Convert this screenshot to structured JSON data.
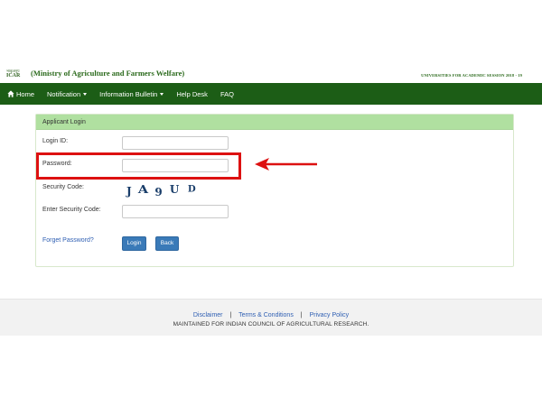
{
  "header": {
    "logo_line1": "भाकृअनुप",
    "logo_line2": "ICAR",
    "ministry": "(Ministry of Agriculture and Farmers Welfare)",
    "session": "UNIVERSITIES FOR ACADEMIC SESSION 2018 - 19"
  },
  "nav": {
    "home": "Home",
    "notification": "Notification",
    "bulletin": "Information Bulletin",
    "helpdesk": "Help Desk",
    "faq": "FAQ",
    "bar_color": "#1c5d16"
  },
  "panel": {
    "title": "Applicant Login",
    "login_id_label": "Login ID:",
    "password_label": "Password:",
    "security_code_label": "Security Code:",
    "enter_security_code_label": "Enter Security Code:",
    "captcha": [
      "J",
      "A",
      "9",
      "U",
      "D"
    ],
    "forgot": "Forget Password?",
    "login_button": "Login",
    "back_button": "Back",
    "header_color": "#b0e0a0"
  },
  "annotation": {
    "highlight_color": "#dd1111"
  },
  "footer": {
    "disclaimer": "Disclaimer",
    "sep": "|",
    "terms": "Terms & Conditions",
    "privacy": "Privacy Policy",
    "note": "MAINTAINED FOR INDIAN COUNCIL OF AGRICULTURAL RESEARCH."
  }
}
